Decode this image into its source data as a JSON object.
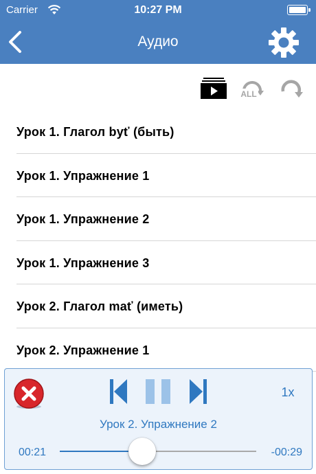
{
  "status_bar": {
    "carrier": "Carrier",
    "time": "10:27 PM",
    "wifi_icon": "wifi-icon",
    "battery_icon": "battery-full-icon"
  },
  "nav": {
    "title": "Аудио",
    "back_icon": "chevron-left-icon",
    "settings_icon": "gear-icon"
  },
  "toolbar": {
    "video_icon": "video-play-icon",
    "repeat_all_label": "ALL",
    "repeat_all_icon": "repeat-all-icon",
    "repeat_one_icon": "repeat-icon"
  },
  "list": {
    "items": [
      {
        "label": "Урок 1. Глагол byť (быть)"
      },
      {
        "label": "Урок 1. Упражнение 1"
      },
      {
        "label": "Урок 1. Упражнение 2"
      },
      {
        "label": "Урок 1. Упражнение 3"
      },
      {
        "label": "Урок 2. Глагол mať (иметь)"
      },
      {
        "label": "Урок 2. Упражнение 1"
      }
    ]
  },
  "player": {
    "close_icon": "close-icon",
    "prev_icon": "skip-previous-icon",
    "pause_icon": "pause-icon",
    "next_icon": "skip-next-icon",
    "speed": "1x",
    "track_title": "Урок 2. Упражнение 2",
    "elapsed": "00:21",
    "remaining": "-00:29",
    "progress_fraction": 0.42
  },
  "colors": {
    "nav_background": "#4a80c0",
    "accent": "#2f78c0",
    "close_red": "#d8262b",
    "player_background": "#ecf3fb"
  }
}
